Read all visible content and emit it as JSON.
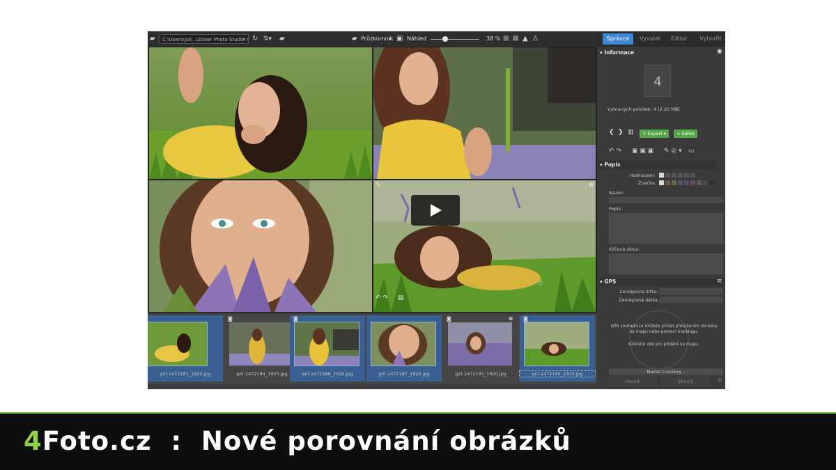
{
  "toolbar": {
    "path": "C:\\Users\\juli...\\Zoner Photo Studio X",
    "explorer_label": "Průzkumník",
    "preview_label": "Náhled",
    "zoom": "38 %"
  },
  "tabs": [
    "Správce",
    "Vyvolat",
    "Editor",
    "Vytvořit"
  ],
  "info": {
    "section_title": "Informace",
    "count": "4",
    "selected_text": "Vybraných položek: 4 (2.20 MB)",
    "export_label": "Export",
    "share_label": "Sdílet"
  },
  "description": {
    "section_title": "Popis",
    "rating_label": "Hodnocení:",
    "tag_label": "Značka:",
    "name_label": "Název:",
    "desc_label": "Popis:",
    "keywords_label": "Klíčová slova:"
  },
  "gps": {
    "section_title": "GPS",
    "lat_label": "Zeměpisná šířka:",
    "lon_label": "Zeměpisná délka:",
    "hint1": "GPS souřadnice můžete přidat přetažením obrázku na mapu nebo pomocí tracklogu.",
    "hint2": "Klikněte zde pro přidání na mapu.",
    "tracklog_button": "Načíst tracklog..."
  },
  "bottom_buttons": {
    "insert": "Vložit",
    "cancel": "Zrušit"
  },
  "filmstrip": [
    {
      "name": "girl-1472181_1920.jpg",
      "selected": true
    },
    {
      "name": "girl-1472184_1920.jpg",
      "selected": false
    },
    {
      "name": "girl-1472186_1920.jpg",
      "selected": true
    },
    {
      "name": "girl-1472187_1920.jpg",
      "selected": true
    },
    {
      "name": "girl-1472191_1920.jpg",
      "selected": false
    },
    {
      "name": "girl-1472195_1920.jpg",
      "selected": true
    }
  ],
  "colors": {
    "accent": "#3f87d9",
    "green": "#56a64b",
    "footer_accent": "#8fd14a"
  },
  "footer": {
    "brand_digit": "4",
    "brand_rest": "Foto.cz  :  Nové porovnání obrázků"
  }
}
